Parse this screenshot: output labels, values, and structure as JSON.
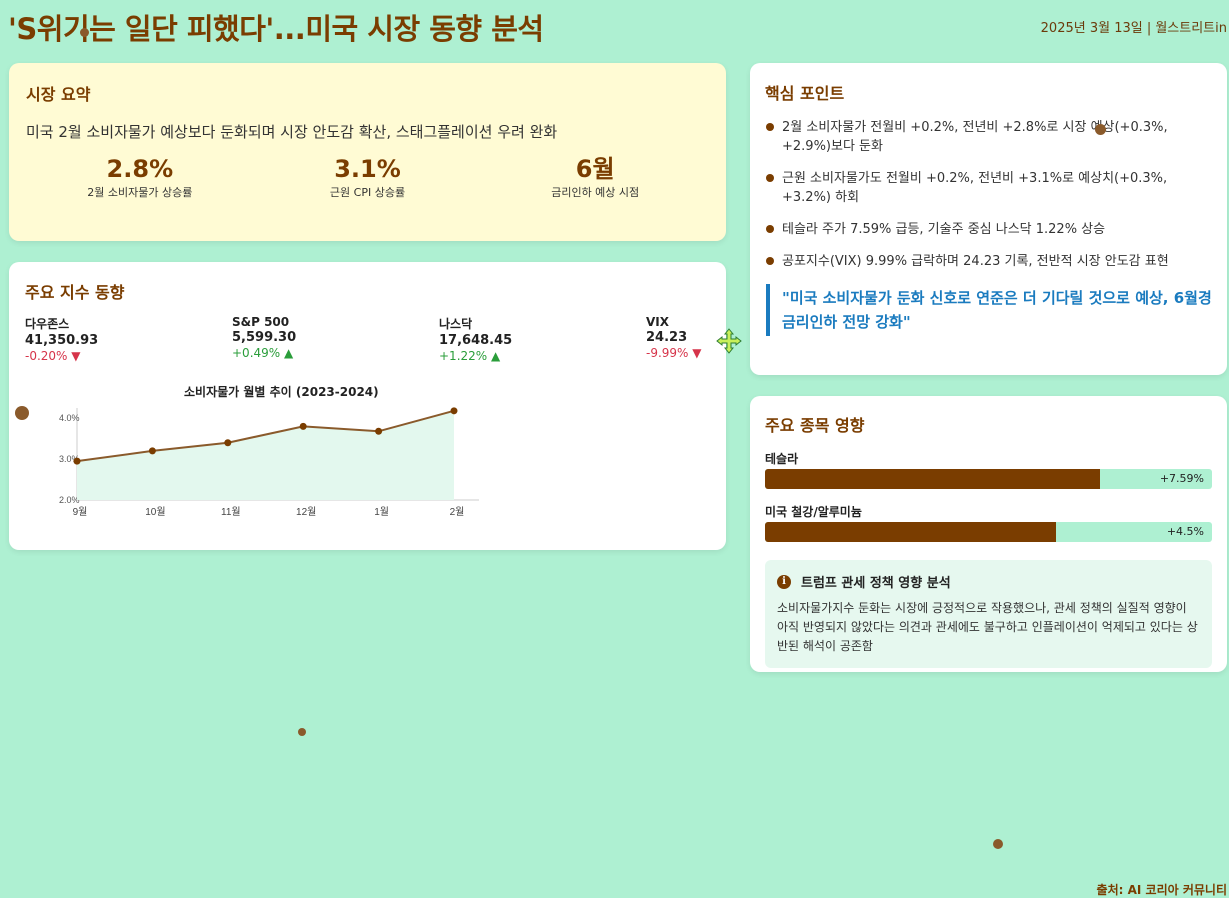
{
  "header": {
    "title": "'S위기는 일단 피했다'...미국 시장 동향 분석",
    "date_source": "2025년 3월 13일 | 월스트리트in"
  },
  "summary": {
    "heading": "시장 요약",
    "description": "미국 2월 소비자물가 예상보다 둔화되며 시장 안도감 확산, 스태그플레이션 우려 완화",
    "stats": [
      {
        "value": "2.8%",
        "label": "2월 소비자물가 상승률"
      },
      {
        "value": "3.1%",
        "label": "근원 CPI 상승률"
      },
      {
        "value": "6월",
        "label": "금리인하 예상 시점"
      }
    ]
  },
  "indices": {
    "heading": "주요 지수 동향",
    "items": [
      {
        "name": "다우존스",
        "value": "41,350.93",
        "change": "-0.20% ▼",
        "direction": "down"
      },
      {
        "name": "S&P 500",
        "value": "5,599.30",
        "change": "+0.49% ▲",
        "direction": "up"
      },
      {
        "name": "나스닥",
        "value": "17,648.45",
        "change": "+1.22% ▲",
        "direction": "up"
      },
      {
        "name": "VIX",
        "value": "24.23",
        "change": "-9.99% ▼",
        "direction": "down"
      }
    ]
  },
  "chart_data": {
    "type": "area",
    "title": "소비자물가 월별 추이 (2023-2024)",
    "categories": [
      "9월",
      "10월",
      "11월",
      "12월",
      "1월",
      "2월"
    ],
    "x_positions": [
      0,
      1,
      2,
      3,
      4,
      5
    ],
    "values": [
      2.95,
      3.2,
      3.4,
      3.8,
      3.68,
      4.18
    ],
    "yticks": [
      "2.0%",
      "3.0%",
      "4.0%"
    ],
    "ylim": [
      2.0,
      4.2
    ],
    "line_color": "#8a5a2b",
    "fill_color": "#e3f8ee",
    "xlabel": "",
    "ylabel": ""
  },
  "keypoints": {
    "heading": "핵심 포인트",
    "items": [
      "2월 소비자물가 전월비 +0.2%, 전년비 +2.8%로 시장 예상(+0.3%, +2.9%)보다 둔화",
      "근원 소비자물가도 전월비 +0.2%, 전년비 +3.1%로 예상치(+0.3%, +3.2%) 하회",
      "테슬라 주가 7.59% 급등, 기술주 중심 나스닥 1.22% 상승",
      "공포지수(VIX) 9.99% 급락하며 24.23 기록, 전반적 시장 안도감 표현"
    ],
    "quote": "\"미국 소비자물가 둔화 신호로 연준은 더 기다릴 것으로 예상, 6월경 금리인하 전망 강화\""
  },
  "stocks": {
    "heading": "주요 종목 영향",
    "items": [
      {
        "name": "테슬라",
        "value": "+7.59%",
        "fill_fraction": 0.75
      },
      {
        "name": "미국 철강/알루미늄",
        "value": "+4.5%",
        "fill_fraction": 0.65
      }
    ],
    "analysis": {
      "title": "트럼프 관세 정책 영향 분석",
      "body": "소비자물가지수 둔화는 시장에 긍정적으로 작용했으나, 관세 정책의 실질적 영향이 아직 반영되지 않았다는 의견과 관세에도 불구하고 인플레이션이 억제되고 있다는 상반된 해석이 공존함"
    }
  },
  "footer": {
    "source": "출처: AI 코리아 커뮤니티"
  },
  "colors": {
    "background": "#aef0d2",
    "accent_brown": "#7a3d00",
    "quote_blue": "#1a7bbf",
    "up_green": "#2a9d3a",
    "down_red": "#d6344a"
  }
}
